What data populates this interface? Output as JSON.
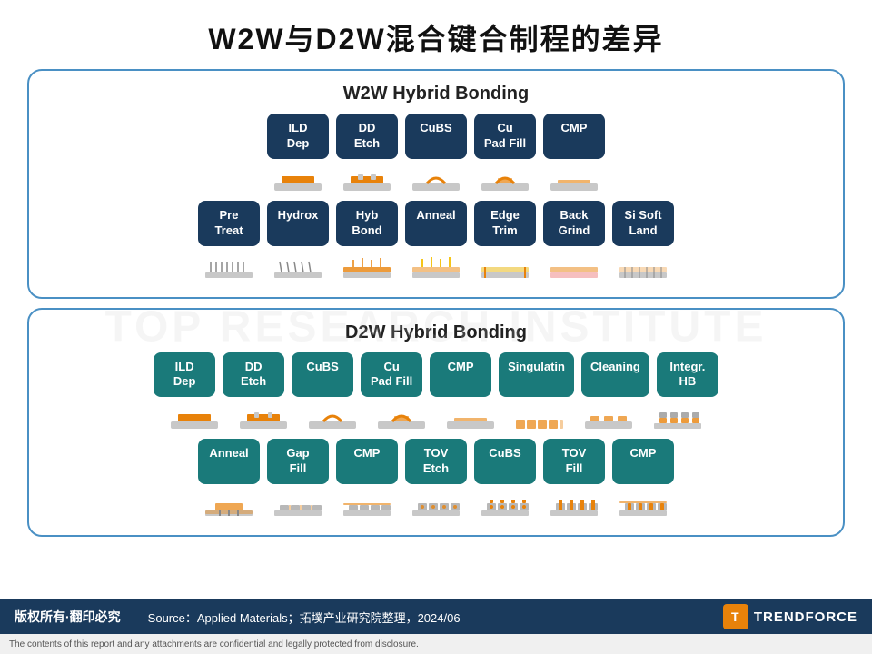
{
  "title": "W2W与D2W混合键合制程的差异",
  "w2w": {
    "section_title": "W2W Hybrid Bonding",
    "row1": [
      "ILD Dep",
      "DD Etch",
      "CuBS",
      "Cu Pad Fill",
      "CMP"
    ],
    "row2": [
      "Pre Treat",
      "Hydrox",
      "Hyb Bond",
      "Anneal",
      "Edge Trim",
      "Back Grind",
      "Si Soft Land"
    ]
  },
  "d2w": {
    "section_title": "D2W Hybrid Bonding",
    "row1": [
      "ILD Dep",
      "DD Etch",
      "CuBS",
      "Cu Pad Fill",
      "CMP",
      "Singulatin",
      "Cleaning",
      "Integr. HB"
    ],
    "row2": [
      "Anneal",
      "Gap Fill",
      "CMP",
      "TOV Etch",
      "CuBS",
      "TOV Fill",
      "CMP"
    ]
  },
  "footer": {
    "copyright": "版权所有·翻印必究",
    "source": "Source：Applied Materials；拓墣产业研究院整理，2024/06",
    "brand": "TRENDFORCE"
  },
  "disclaimer": "The contents of this report and any attachments are confidential and legally protected from disclosure."
}
